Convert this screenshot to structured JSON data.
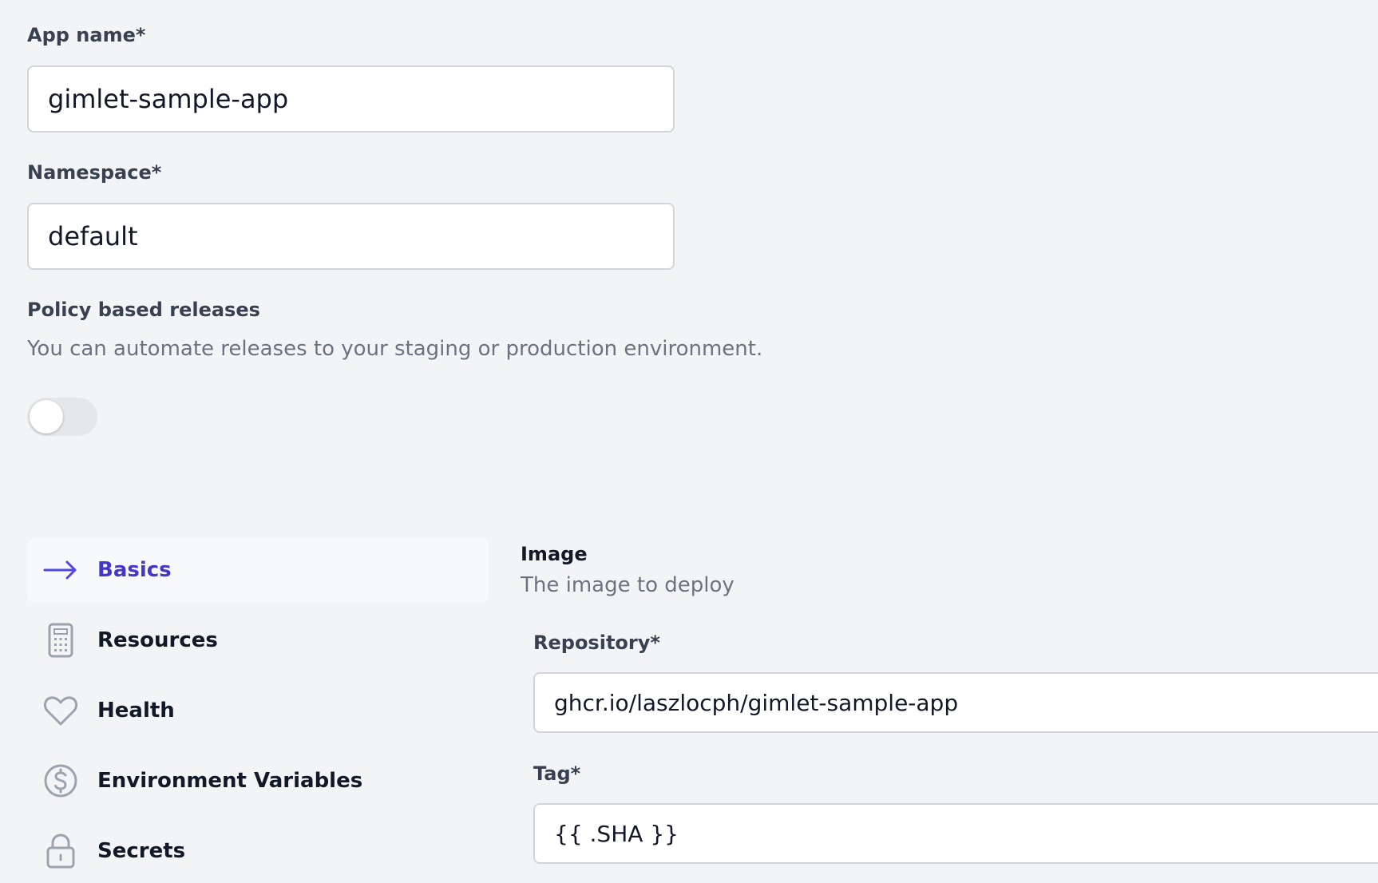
{
  "app_name": {
    "label": "App name*",
    "value": "gimlet-sample-app"
  },
  "namespace": {
    "label": "Namespace*",
    "value": "default"
  },
  "policy": {
    "title": "Policy based releases",
    "description": "You can automate releases to your staging or production environment.",
    "enabled": false
  },
  "nav": {
    "items": [
      {
        "label": "Basics",
        "icon": "arrow-right-icon",
        "active": true
      },
      {
        "label": "Resources",
        "icon": "calculator-icon",
        "active": false
      },
      {
        "label": "Health",
        "icon": "heart-icon",
        "active": false
      },
      {
        "label": "Environment Variables",
        "icon": "currency-dollar-icon",
        "active": false
      },
      {
        "label": "Secrets",
        "icon": "lock-icon",
        "active": false
      }
    ]
  },
  "image_section": {
    "title": "Image",
    "description": "The image to deploy",
    "repository": {
      "label": "Repository*",
      "value": "ghcr.io/laszlocph/gimlet-sample-app"
    },
    "tag": {
      "label": "Tag*",
      "value": "{{ .SHA }}"
    }
  },
  "colors": {
    "background": "#f3f4f6",
    "accent": "#4f46e5",
    "active_text": "#4338ca",
    "icon_gray": "#9ca3af"
  }
}
